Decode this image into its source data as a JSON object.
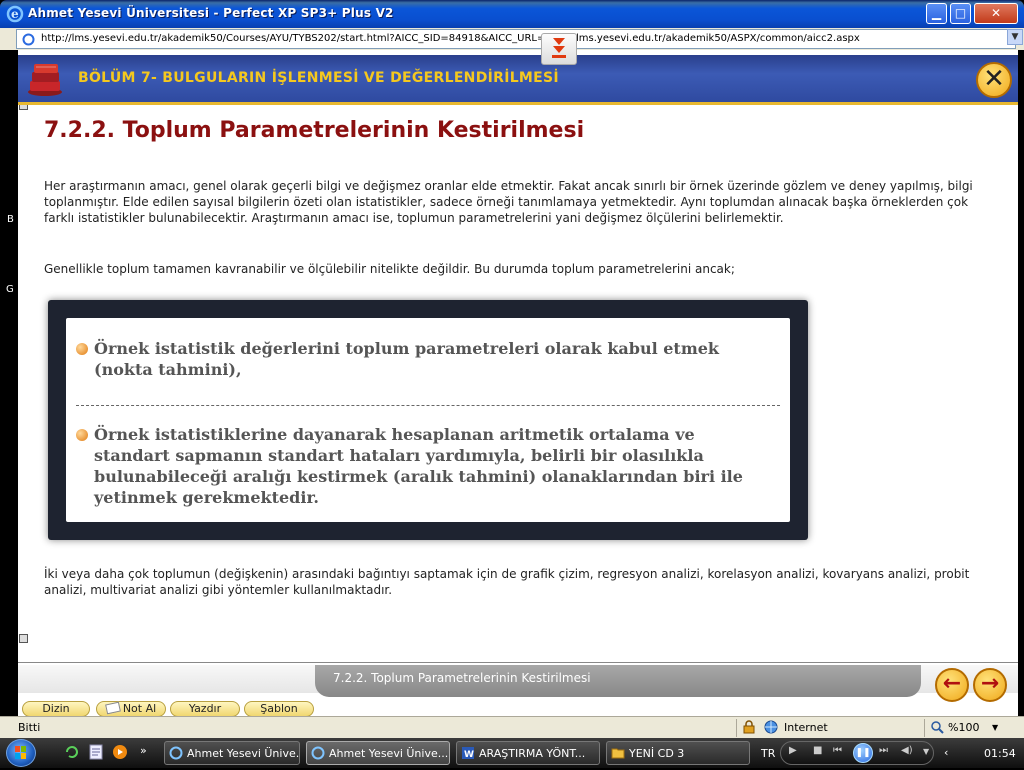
{
  "window": {
    "title": "Ahmet Yesevi Üniversitesi - Perfect XP SP3+ Plus V2",
    "minimize": "▁",
    "maximize": "□",
    "close": "✕"
  },
  "address": {
    "url": "http://lms.yesevi.edu.tr/akademik50/Courses/AYU/TYBS202/start.html?AICC_SID=84918&AICC_URL=http://lms.yesevi.edu.tr/akademik50/ASPX/common/aicc2.aspx"
  },
  "side_letters": [
    "B",
    "G"
  ],
  "header": {
    "chapter_title": "BÖLÜM 7- BULGULARIN İŞLENMESİ VE DEĞERLENDİRİLMESİ",
    "close_glyph": "✕"
  },
  "content": {
    "section_title": "7.2.2. Toplum Parametrelerinin Kestirilmesi",
    "paragraph1": "Her araştırmanın amacı, genel olarak geçerli bilgi ve değişmez oranlar elde etmektir. Fakat ancak sınırlı bir örnek üzerinde gözlem ve deney yapılmış, bilgi toplanmıştır. Elde edilen sayısal bilgilerin özeti olan istatistikler, sadece örneği tanımlamaya yetmektedir. Aynı toplumdan alınacak başka örneklerden çok farklı istatistikler bulunabilecektir. Araştırmanın amacı ise, toplumun parametrelerini  yani değişmez ölçülerini belirlemektir.",
    "paragraph2": "Genellikle toplum tamamen kavranabilir ve ölçülebilir nitelikte değildir. Bu durumda toplum parametrelerini ancak;",
    "bullets": [
      "Örnek istatistik değerlerini toplum parametreleri olarak kabul etmek (nokta tahmini),",
      "Örnek istatistiklerine dayanarak hesaplanan aritmetik ortalama ve standart sapmanın standart hataları yardımıyla, belirli bir olasılıkla bulunabileceği aralığı kestirmek (aralık tahmini) olanaklarından biri ile yetinmek gerekmektedir."
    ],
    "paragraph3": "İki veya daha çok toplumun (değişkenin) arasındaki bağıntıyı saptamak için de grafik çizim, regresyon analizi, korelasyon analizi, kovaryans analizi, probit analizi, multivariat analizi gibi yöntemler kullanılmaktadır."
  },
  "bottom_nav": {
    "page_label": "7.2.2. Toplum Parametrelerinin Kestirilmesi",
    "prev_glyph": "←",
    "next_glyph": "→",
    "buttons": [
      "Dizin",
      "Not Al",
      "Yazdır",
      "Şablon"
    ]
  },
  "status": {
    "left": "Bitti",
    "zone": "Internet",
    "zoom": "%100"
  },
  "taskbar": {
    "tasks": [
      "Ahmet Yesevi Ünive...",
      "Ahmet Yesevi Ünive...",
      "ARAŞTIRMA YÖNT...",
      "YENİ CD 3"
    ],
    "language": "TR",
    "clock": "01:54"
  },
  "colors": {
    "section_title": "#8b1010",
    "chapter_title": "#f5c81e",
    "header_bg": "#2f4aa0"
  }
}
